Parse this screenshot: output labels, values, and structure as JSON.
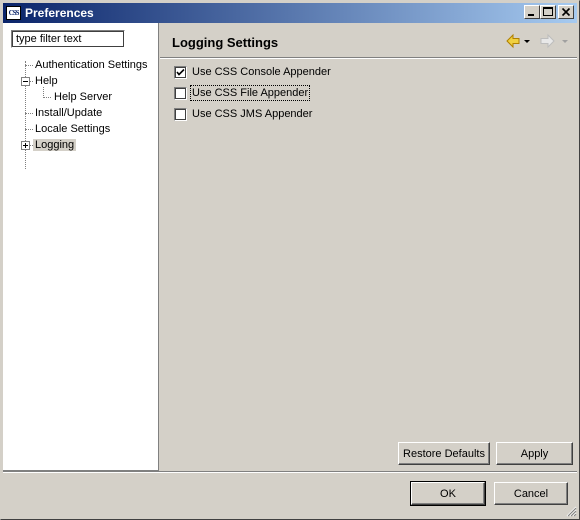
{
  "window": {
    "title": "Preferences",
    "app_icon_text": "CSS"
  },
  "sidebar": {
    "filter_placeholder": "type filter text",
    "items": [
      {
        "label": "Authentication Settings"
      },
      {
        "label": "Help"
      },
      {
        "label": "Help Server"
      },
      {
        "label": "Install/Update"
      },
      {
        "label": "Locale Settings"
      },
      {
        "label": "Logging"
      }
    ]
  },
  "page": {
    "title": "Logging Settings",
    "options": [
      {
        "label": "Use CSS Console Appender",
        "checked": true
      },
      {
        "label": "Use CSS File Appender",
        "checked": false
      },
      {
        "label": "Use CSS JMS Appender",
        "checked": false
      }
    ],
    "restore_defaults_label": "Restore Defaults",
    "apply_label": "Apply"
  },
  "footer": {
    "ok_label": "OK",
    "cancel_label": "Cancel"
  },
  "colors": {
    "titlebar_start": "#0a246a",
    "titlebar_end": "#a6caf0",
    "face": "#d4d0c8",
    "nav_back_arrow": "#e8c030"
  }
}
